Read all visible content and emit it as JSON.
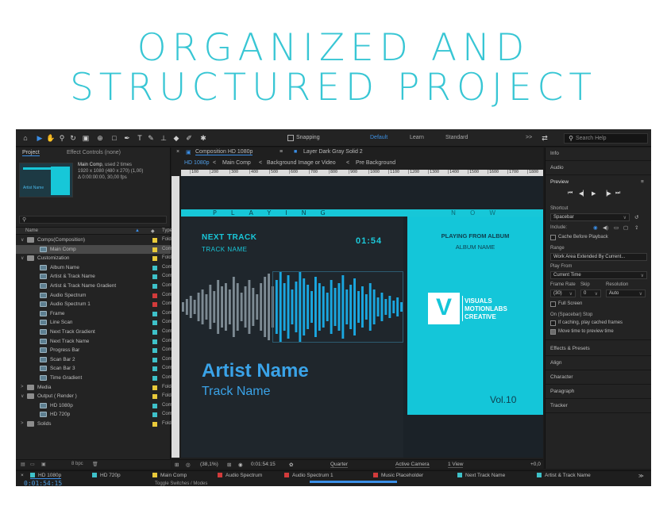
{
  "headline": {
    "line1": "ORGANIZED AND",
    "line2": "STRUCTURED PROJECT"
  },
  "toolbar": {
    "snapping_label": "Snapping",
    "workspaces": [
      "Default",
      "Learn",
      "Standard"
    ],
    "search_placeholder": "Search Help",
    "more_label": ">>"
  },
  "project_panel": {
    "tab_project": "Project",
    "tab_effect_controls": "Effect Controls (none)",
    "comp_name": "Main Comp",
    "comp_used": ", used 2 times",
    "comp_res": "1920 x 1080  (480 x 270) (1,00)",
    "comp_dur": "Δ 0:00:00:00, 30,00 fps",
    "thumb_text": "Artist Name",
    "col_name": "Name",
    "col_type": "Type",
    "footer_bpc": "8 bpc",
    "items": [
      {
        "name": "Comps(Composition)",
        "kind": "folder",
        "arrow": "∨",
        "indent": 0,
        "label": "#e8c93a",
        "type": "Folder",
        "selected": false
      },
      {
        "name": "Main Comp",
        "kind": "comp",
        "arrow": "",
        "indent": 1,
        "label": "#e8c93a",
        "type": "Compo",
        "selected": true
      },
      {
        "name": "Customization",
        "kind": "folder",
        "arrow": "∨",
        "indent": 0,
        "label": "#e8c93a",
        "type": "Folder",
        "selected": false
      },
      {
        "name": "Album Name",
        "kind": "comp",
        "arrow": "",
        "indent": 1,
        "label": "#3ec1c9",
        "type": "Compo",
        "selected": false
      },
      {
        "name": "Artist & Track Name",
        "kind": "comp",
        "arrow": "",
        "indent": 1,
        "label": "#3ec1c9",
        "type": "Compo",
        "selected": false
      },
      {
        "name": "Artist & Track Name Gradient",
        "kind": "comp",
        "arrow": "",
        "indent": 1,
        "label": "#3ec1c9",
        "type": "Compo",
        "selected": false
      },
      {
        "name": "Audio Spectrum",
        "kind": "comp",
        "arrow": "",
        "indent": 1,
        "label": "#d23b3b",
        "type": "Compo",
        "selected": false
      },
      {
        "name": "Audio Spectrum 1",
        "kind": "comp",
        "arrow": "",
        "indent": 1,
        "label": "#d23b3b",
        "type": "Compo",
        "selected": false
      },
      {
        "name": "Frame",
        "kind": "comp",
        "arrow": "",
        "indent": 1,
        "label": "#3ec1c9",
        "type": "Compo",
        "selected": false
      },
      {
        "name": "Line Scan",
        "kind": "comp",
        "arrow": "",
        "indent": 1,
        "label": "#3ec1c9",
        "type": "Compo",
        "selected": false
      },
      {
        "name": "Next Track Gradient",
        "kind": "comp",
        "arrow": "",
        "indent": 1,
        "label": "#3ec1c9",
        "type": "Compo",
        "selected": false
      },
      {
        "name": "Next Track Name",
        "kind": "comp",
        "arrow": "",
        "indent": 1,
        "label": "#3ec1c9",
        "type": "Compo",
        "selected": false
      },
      {
        "name": "Progress Bar",
        "kind": "comp",
        "arrow": "",
        "indent": 1,
        "label": "#3ec1c9",
        "type": "Compo",
        "selected": false
      },
      {
        "name": "Scan Bar 2",
        "kind": "comp",
        "arrow": "",
        "indent": 1,
        "label": "#3ec1c9",
        "type": "Compo",
        "selected": false
      },
      {
        "name": "Scan Bar 3",
        "kind": "comp",
        "arrow": "",
        "indent": 1,
        "label": "#3ec1c9",
        "type": "Compo",
        "selected": false
      },
      {
        "name": "Time Gradient",
        "kind": "comp",
        "arrow": "",
        "indent": 1,
        "label": "#3ec1c9",
        "type": "Compo",
        "selected": false
      },
      {
        "name": "Media",
        "kind": "folder",
        "arrow": ">",
        "indent": 0,
        "label": "#e8c93a",
        "type": "Folder",
        "selected": false
      },
      {
        "name": "Output ( Render )",
        "kind": "folder",
        "arrow": "∨",
        "indent": 0,
        "label": "#e8c93a",
        "type": "Folder",
        "selected": false
      },
      {
        "name": "HD 1080p",
        "kind": "comp",
        "arrow": "",
        "indent": 1,
        "label": "#3ec1c9",
        "type": "Compo",
        "selected": false
      },
      {
        "name": "HD 720p",
        "kind": "comp",
        "arrow": "",
        "indent": 1,
        "label": "#3ec1c9",
        "type": "Compo",
        "selected": false
      },
      {
        "name": "Solids",
        "kind": "folder",
        "arrow": ">",
        "indent": 0,
        "label": "#e8c93a",
        "type": "Folder",
        "selected": false
      }
    ]
  },
  "viewer": {
    "tab_composition": "Composition HD 1080p",
    "tab_layer": "Layer  Dark Gray Solid 2",
    "crumbs": [
      "HD 1080p",
      "Main Comp",
      "Background Image or Video",
      "Pre Background"
    ],
    "ruler_ticks": [
      "|100",
      "|200",
      "|300",
      "|400",
      "|500",
      "|600",
      "|700",
      "|800",
      "|900",
      "|1000",
      "|1100",
      "|1200",
      "|1300",
      "|1400",
      "|1500",
      "|1600",
      "|1700",
      "|1800"
    ],
    "footer": {
      "zoom": "(38,1%)",
      "timecode": "0:01:54:15",
      "quality": "Quarter",
      "camera": "Active Camera",
      "views": "1 View",
      "offset": "+0,0"
    }
  },
  "player": {
    "strip_left": "PLAYING",
    "strip_right": "NOW",
    "next_track": "NEXT TRACK",
    "track_name_small": "TRACK NAME",
    "time": "01:54",
    "artist": "Artist Name",
    "track_name": "Track Name",
    "playing_from": "PLAYING FROM ALBUM",
    "album_name": "ALBUM NAME",
    "brand_1": "VISUALS",
    "brand_2": "MOTIONLABS",
    "brand_3": "CREATIVE",
    "volume": "Vol.10",
    "waveform": [
      6,
      10,
      14,
      9,
      18,
      22,
      16,
      28,
      20,
      34,
      26,
      30,
      22,
      38,
      30,
      18,
      26,
      34,
      24,
      16,
      30,
      38,
      42,
      26,
      34,
      46,
      30,
      40,
      22,
      32,
      44,
      36,
      28,
      20,
      38,
      30,
      26,
      18,
      34,
      24,
      30,
      40,
      22,
      28,
      36,
      20,
      26,
      16,
      30,
      22,
      12,
      18,
      10,
      14,
      8,
      12,
      6
    ]
  },
  "right_panel": {
    "info": "Info",
    "audio": "Audio",
    "preview": "Preview",
    "shortcut_label": "Shortcut",
    "shortcut_value": "Spacebar",
    "include_label": "Include:",
    "cache_before": "Cache Before Playback",
    "range_label": "Range",
    "range_value": "Work Area Extended By Current...",
    "play_from_label": "Play From",
    "play_from_value": "Current Time",
    "frame_rate_label": "Frame Rate",
    "skip_label": "Skip",
    "resolution_label": "Resolution",
    "frame_rate_value": "(30)",
    "skip_value": "0",
    "resolution_value": "Auto",
    "full_screen": "Full Screen",
    "on_stop_label": "On (Spacebar) Stop",
    "if_caching": "If caching, play cached frames",
    "move_time": "Move time to preview time",
    "sections": [
      "Effects & Presets",
      "Align",
      "Character",
      "Paragraph",
      "Tracker"
    ]
  },
  "timeline": {
    "tabs": [
      {
        "label": "HD 1080p",
        "color": "#3ec1c9"
      },
      {
        "label": "HD 720p",
        "color": "#3ec1c9"
      },
      {
        "label": "Main Comp",
        "color": "#e8c93a"
      },
      {
        "label": "Audio Spectrum",
        "color": "#d23b3b"
      },
      {
        "label": "Audio Spectrum 1",
        "color": "#d23b3b"
      },
      {
        "label": "Music Placeholder",
        "color": "#d23b3b"
      },
      {
        "label": "Next Track Name",
        "color": "#3ec1c9"
      },
      {
        "label": "Artist & Track Name",
        "color": "#3ec1c9"
      }
    ],
    "time": "0:01:54:15",
    "toggle_label": "Toggle Switches / Modes"
  },
  "colors": {
    "accent": "#38c6d4",
    "ae_blue": "#3a8ee6",
    "cyan": "#14c6d9"
  }
}
